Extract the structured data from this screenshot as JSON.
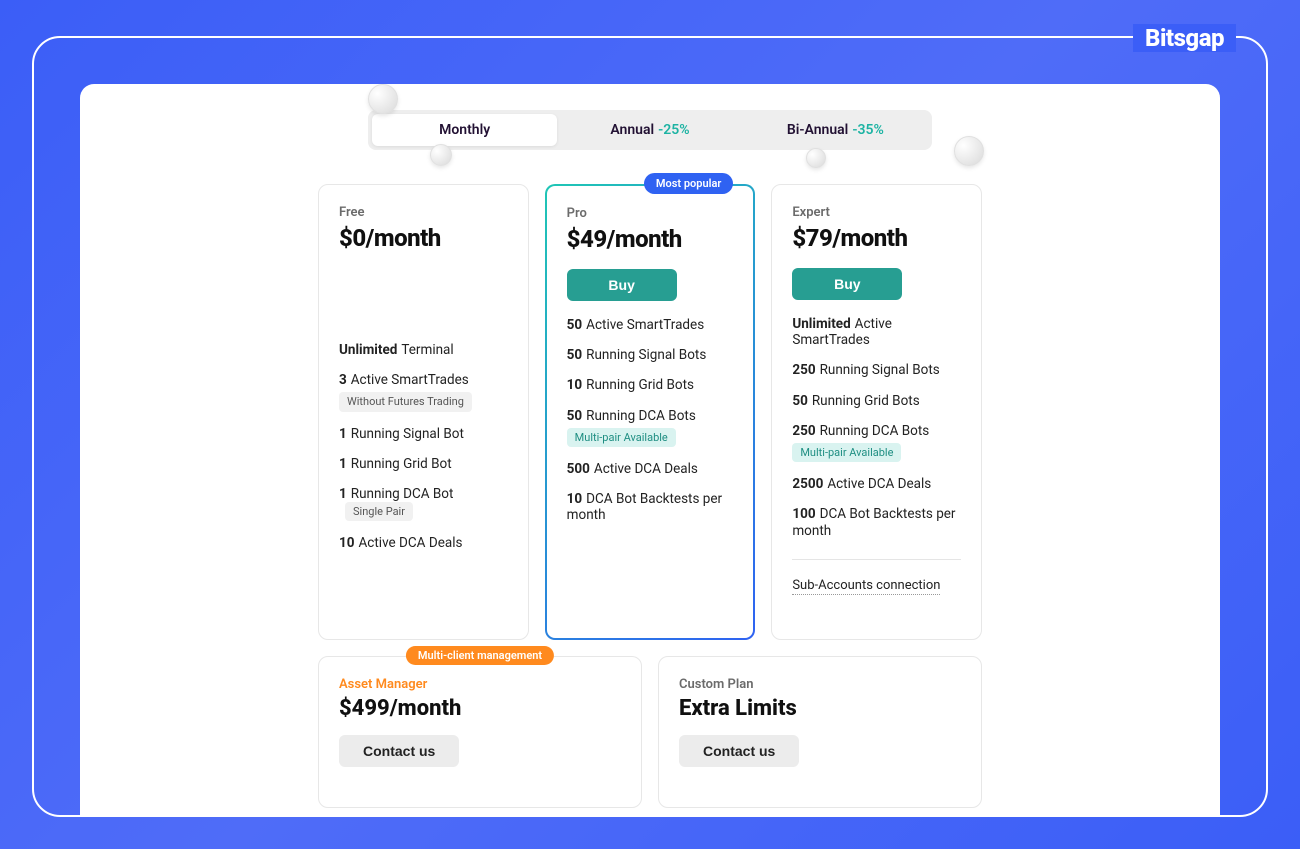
{
  "brand": "Bitsgap",
  "period_tabs": [
    {
      "label": "Monthly",
      "discount": "",
      "active": true
    },
    {
      "label": "Annual",
      "discount": "-25%",
      "active": false
    },
    {
      "label": "Bi-Annual",
      "discount": "-35%",
      "active": false
    }
  ],
  "badges": {
    "most_popular": "Most popular",
    "multi_client": "Multi-client management"
  },
  "plans": {
    "free": {
      "name": "Free",
      "price": "$0/month",
      "features": [
        {
          "qty": "Unlimited",
          "text": "Terminal"
        },
        {
          "qty": "3",
          "text": "Active SmartTrades",
          "pill": "Without Futures Trading",
          "pill_style": "gray"
        },
        {
          "qty": "1",
          "text": "Running Signal Bot"
        },
        {
          "qty": "1",
          "text": "Running Grid Bot"
        },
        {
          "qty": "1",
          "text": "Running DCA Bot",
          "pill": "Single Pair",
          "pill_style": "gray-inline"
        },
        {
          "qty": "10",
          "text": "Active DCA Deals"
        }
      ]
    },
    "pro": {
      "name": "Pro",
      "price": "$49/month",
      "cta": "Buy",
      "features": [
        {
          "qty": "50",
          "text": "Active SmartTrades"
        },
        {
          "qty": "50",
          "text": "Running Signal Bots"
        },
        {
          "qty": "10",
          "text": "Running Grid Bots"
        },
        {
          "qty": "50",
          "text": "Running DCA Bots",
          "pill": "Multi-pair Available",
          "pill_style": "teal"
        },
        {
          "qty": "500",
          "text": "Active DCA Deals"
        },
        {
          "qty": "10",
          "text": "DCA Bot Backtests per month"
        }
      ]
    },
    "expert": {
      "name": "Expert",
      "price": "$79/month",
      "cta": "Buy",
      "features": [
        {
          "qty": "Unlimited",
          "text": "Active SmartTrades"
        },
        {
          "qty": "250",
          "text": "Running Signal Bots"
        },
        {
          "qty": "50",
          "text": "Running Grid Bots"
        },
        {
          "qty": "250",
          "text": "Running DCA Bots",
          "pill": "Multi-pair Available",
          "pill_style": "teal"
        },
        {
          "qty": "2500",
          "text": "Active DCA Deals"
        },
        {
          "qty": "100",
          "text": "DCA Bot Backtests per month"
        }
      ],
      "extra": "Sub-Accounts connection"
    },
    "asset_manager": {
      "name": "Asset Manager",
      "price": "$499/month",
      "cta": "Contact us"
    },
    "custom": {
      "name": "Custom Plan",
      "subtitle": "Extra Limits",
      "cta": "Contact us"
    }
  }
}
